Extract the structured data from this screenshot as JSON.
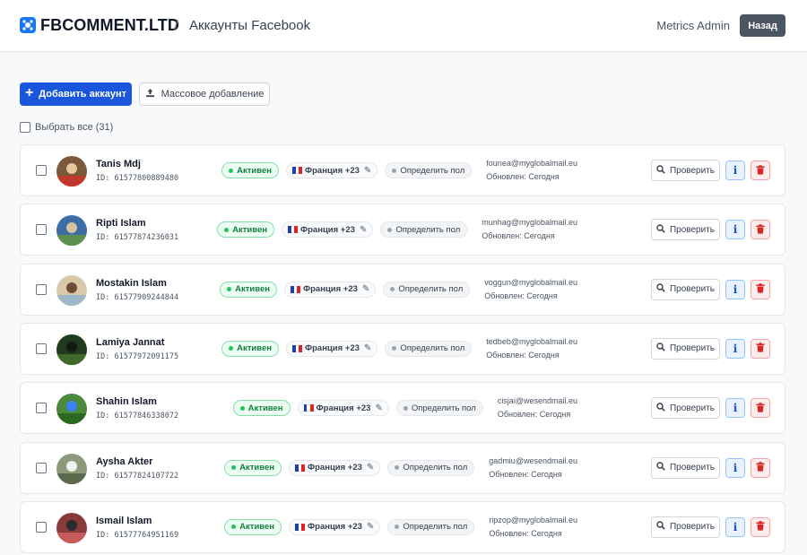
{
  "header": {
    "brand": "FBCOMMENT.LTD",
    "separator": "/",
    "page_title": "Аккаунты Facebook",
    "user_name": "Metrics Admin",
    "back_label": "Назад"
  },
  "toolbar": {
    "add_label": "Добавить аккаунт",
    "bulk_label": "Массовое добавление",
    "select_all_label": "Выбрать все (31)"
  },
  "row_labels": {
    "check_label": "Проверить",
    "info_label": "i"
  },
  "accounts": [
    {
      "name": "Tanis Mdj",
      "id": "ID: 61577800889480",
      "status": "Активен",
      "country": "Франция +23",
      "gender": "Определить пол",
      "email": "founea@myglobalmail.eu",
      "updated": "Обновлен: Сегодня"
    },
    {
      "name": "Ripti Islam",
      "id": "ID: 61577874236031",
      "status": "Активен",
      "country": "Франция +23",
      "gender": "Определить пол",
      "email": "munhag@myglobalmail.eu",
      "updated": "Обновлен: Сегодня"
    },
    {
      "name": "Mostakin Islam",
      "id": "ID: 61577909244844",
      "status": "Активен",
      "country": "Франция +23",
      "gender": "Определить пол",
      "email": "voggun@myglobalmail.eu",
      "updated": "Обновлен: Сегодня"
    },
    {
      "name": "Lamiya Jannat",
      "id": "ID: 61577972091175",
      "status": "Активен",
      "country": "Франция +23",
      "gender": "Определить пол",
      "email": "tedbeb@myglobalmail.eu",
      "updated": "Обновлен: Сегодня"
    },
    {
      "name": "Shahin Islam",
      "id": "ID: 61577846338072",
      "status": "Активен",
      "country": "Франция +23",
      "gender": "Определить пол",
      "email": "cisjai@wesendmail.eu",
      "updated": "Обновлен: Сегодня"
    },
    {
      "name": "Aysha Akter",
      "id": "ID: 61577824107722",
      "status": "Активен",
      "country": "Франция +23",
      "gender": "Определить пол",
      "email": "gadmiu@wesendmail.eu",
      "updated": "Обновлен: Сегодня"
    },
    {
      "name": "Ismail Islam",
      "id": "ID: 61577764951169",
      "status": "Активен",
      "country": "Франция +23",
      "gender": "Определить пол",
      "email": "ripzop@myglobalmail.eu",
      "updated": "Обновлен: Сегодня"
    }
  ],
  "colors": {
    "primary": "#1a56db",
    "active_green": "#15803d",
    "danger": "#dc2626",
    "back_button": "#4b5563"
  },
  "icons": {
    "logo": "logo-icon",
    "add": "plus-icon",
    "bulk": "upload-icon",
    "check": "search-icon",
    "info": "info-icon",
    "delete": "trash-icon",
    "edit": "edit-icon",
    "flag": "flag-france-icon"
  }
}
